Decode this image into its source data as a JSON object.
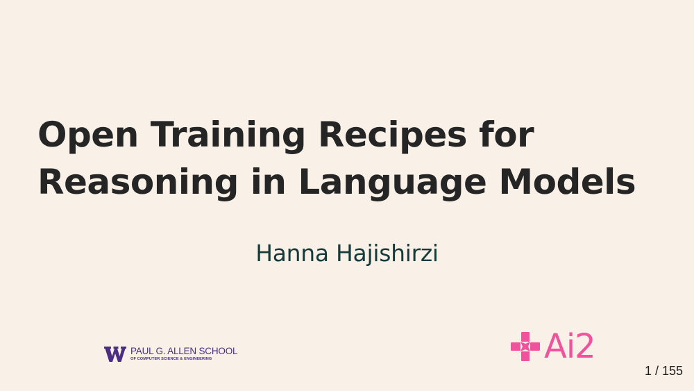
{
  "slide": {
    "title_lines": [
      "Open Training Recipes for",
      "Reasoning in Language Models"
    ],
    "author": "Hanna Hajishirzi",
    "page_current": "1",
    "page_total": "155",
    "page_counter": "1 / 155"
  },
  "logos": {
    "uw": {
      "name": "PAUL G. ALLEN SCHOOL",
      "subtitle": "OF COMPUTER SCIENCE & ENGINEERING",
      "color": "#4b2e83",
      "icon": "uw-w-icon"
    },
    "ai2": {
      "name": "Ai2",
      "color": "#f0529c",
      "icon": "ai2-sparkle-icon"
    }
  },
  "colors": {
    "background": "#f9f0e8",
    "title": "#252525",
    "author": "#163a3a"
  }
}
